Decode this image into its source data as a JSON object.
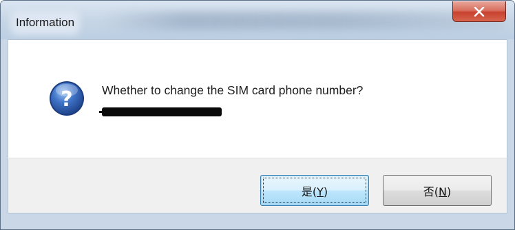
{
  "window": {
    "title": "Information"
  },
  "dialog": {
    "icon": "question-icon",
    "message": "Whether to change the SIM card phone number?"
  },
  "buttons": {
    "yes": {
      "text": "是",
      "mnemonic": "Y"
    },
    "no": {
      "text": "否",
      "mnemonic": "N"
    }
  },
  "colors": {
    "titlebar": "#c7d6e6",
    "close_button": "#c8422f",
    "default_button": "#bee6fd",
    "icon_blue": "#2f5fae"
  }
}
